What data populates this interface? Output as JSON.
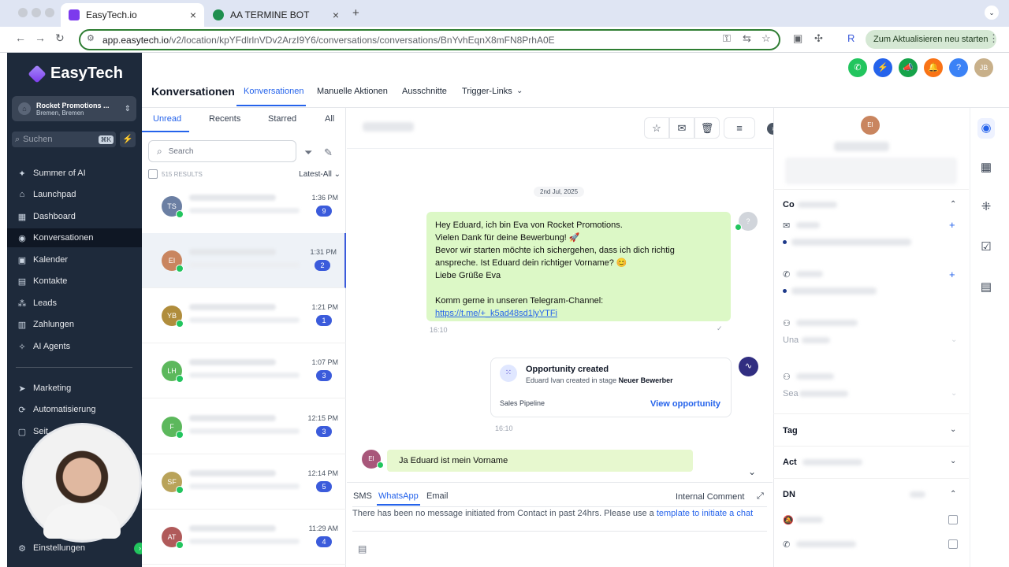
{
  "browser": {
    "tabs": [
      {
        "title": "EasyTech.io",
        "close": "×"
      },
      {
        "title": "AA TERMINE BOT",
        "close": "×"
      }
    ],
    "new_tab": "+",
    "url_host": "app.easytech.io",
    "url_path": "/v2/location/kpYFdlrlnVDv2ArzI9Y6/conversations/conversations/BnYvhEqnX8mFN8PrhA0E",
    "update_button": "Zum Aktualisieren neu starten",
    "nav": {
      "back": "←",
      "forward": "→",
      "reload": "↻"
    }
  },
  "sidebar": {
    "brand": "EasyTech",
    "location_name": "Rocket Promotions ...",
    "location_city": "Bremen, Bremen",
    "search_placeholder": "Suchen",
    "search_shortcut": "⌘K",
    "items": [
      {
        "label": "Summer of AI",
        "icon": "✦"
      },
      {
        "label": "Launchpad",
        "icon": "⌂"
      },
      {
        "label": "Dashboard",
        "icon": "▦"
      },
      {
        "label": "Konversationen",
        "icon": "◉"
      },
      {
        "label": "Kalender",
        "icon": "▣"
      },
      {
        "label": "Kontakte",
        "icon": "▤"
      },
      {
        "label": "Leads",
        "icon": "⁂"
      },
      {
        "label": "Zahlungen",
        "icon": "▥"
      },
      {
        "label": "AI Agents",
        "icon": "✧"
      }
    ],
    "items2": [
      {
        "label": "Marketing",
        "icon": "➤"
      },
      {
        "label": "Automatisierung",
        "icon": "⟳"
      },
      {
        "label": "Seit",
        "icon": "▢"
      }
    ],
    "settings": "Einstellungen"
  },
  "topbar": {
    "title": "Konversationen",
    "tabs": [
      "Konversationen",
      "Manuelle Aktionen",
      "Ausschnitte",
      "Trigger-Links"
    ],
    "user_initials": "JB"
  },
  "list": {
    "filters": [
      "Unread",
      "Recents",
      "Starred",
      "All"
    ],
    "search_placeholder": "Search",
    "results": "515 RESULTS",
    "sort": "Latest-All",
    "conversations": [
      {
        "initials": "TS",
        "time": "1:36 PM",
        "count": "9",
        "color": "#6b7fa3"
      },
      {
        "initials": "EI",
        "time": "1:31 PM",
        "count": "2",
        "color": "#c9855f"
      },
      {
        "initials": "YB",
        "time": "1:21 PM",
        "count": "1",
        "color": "#b08d3c"
      },
      {
        "initials": "LH",
        "time": "1:07 PM",
        "count": "3",
        "color": "#5cb85c"
      },
      {
        "initials": "F",
        "time": "12:15 PM",
        "count": "3",
        "color": "#5cb85c"
      },
      {
        "initials": "SF",
        "time": "12:14 PM",
        "count": "5",
        "color": "#b9a35a"
      },
      {
        "initials": "AT",
        "time": "11:29 AM",
        "count": "4",
        "color": "#b05a5a"
      }
    ]
  },
  "chat": {
    "date": "2nd Jul, 2025",
    "out_lines": [
      "Hey Eduard, ich bin Eva von Rocket Promotions.",
      "Vielen Dank für deine Bewerbung! 🚀",
      "Bevor wir starten möchte ich sichergehen, dass ich dich richtig",
      "anspreche. Ist Eduard dein richtiger Vorname? 😊",
      "Liebe Grüße Eva",
      "",
      "Komm gerne in unseren Telegram-Channel:"
    ],
    "out_link": "https://t.me/+_k5ad48sd1lyYTFi",
    "out_time": "16:10",
    "opportunity": {
      "title": "Opportunity created",
      "sub_prefix": "Eduard Ivan created in stage",
      "stage": "Neuer Bewerber",
      "pipeline": "Sales Pipeline",
      "link": "View opportunity",
      "time": "16:10"
    },
    "in_initials": "EI",
    "in_message": "Ja Eduard ist mein Vorname"
  },
  "composer": {
    "tabs": [
      "SMS",
      "WhatsApp",
      "Email"
    ],
    "internal_comment": "Internal Comment",
    "notice": "There has been no message initiated from Contact in past 24hrs. Please use a",
    "notice_link": "template to initiate a chat"
  },
  "contact": {
    "initials": "EI",
    "contact_header": "Co",
    "assigned": "Una",
    "search": "Sea",
    "tags": "Tag",
    "actions": "Act",
    "dnd": "DN"
  }
}
